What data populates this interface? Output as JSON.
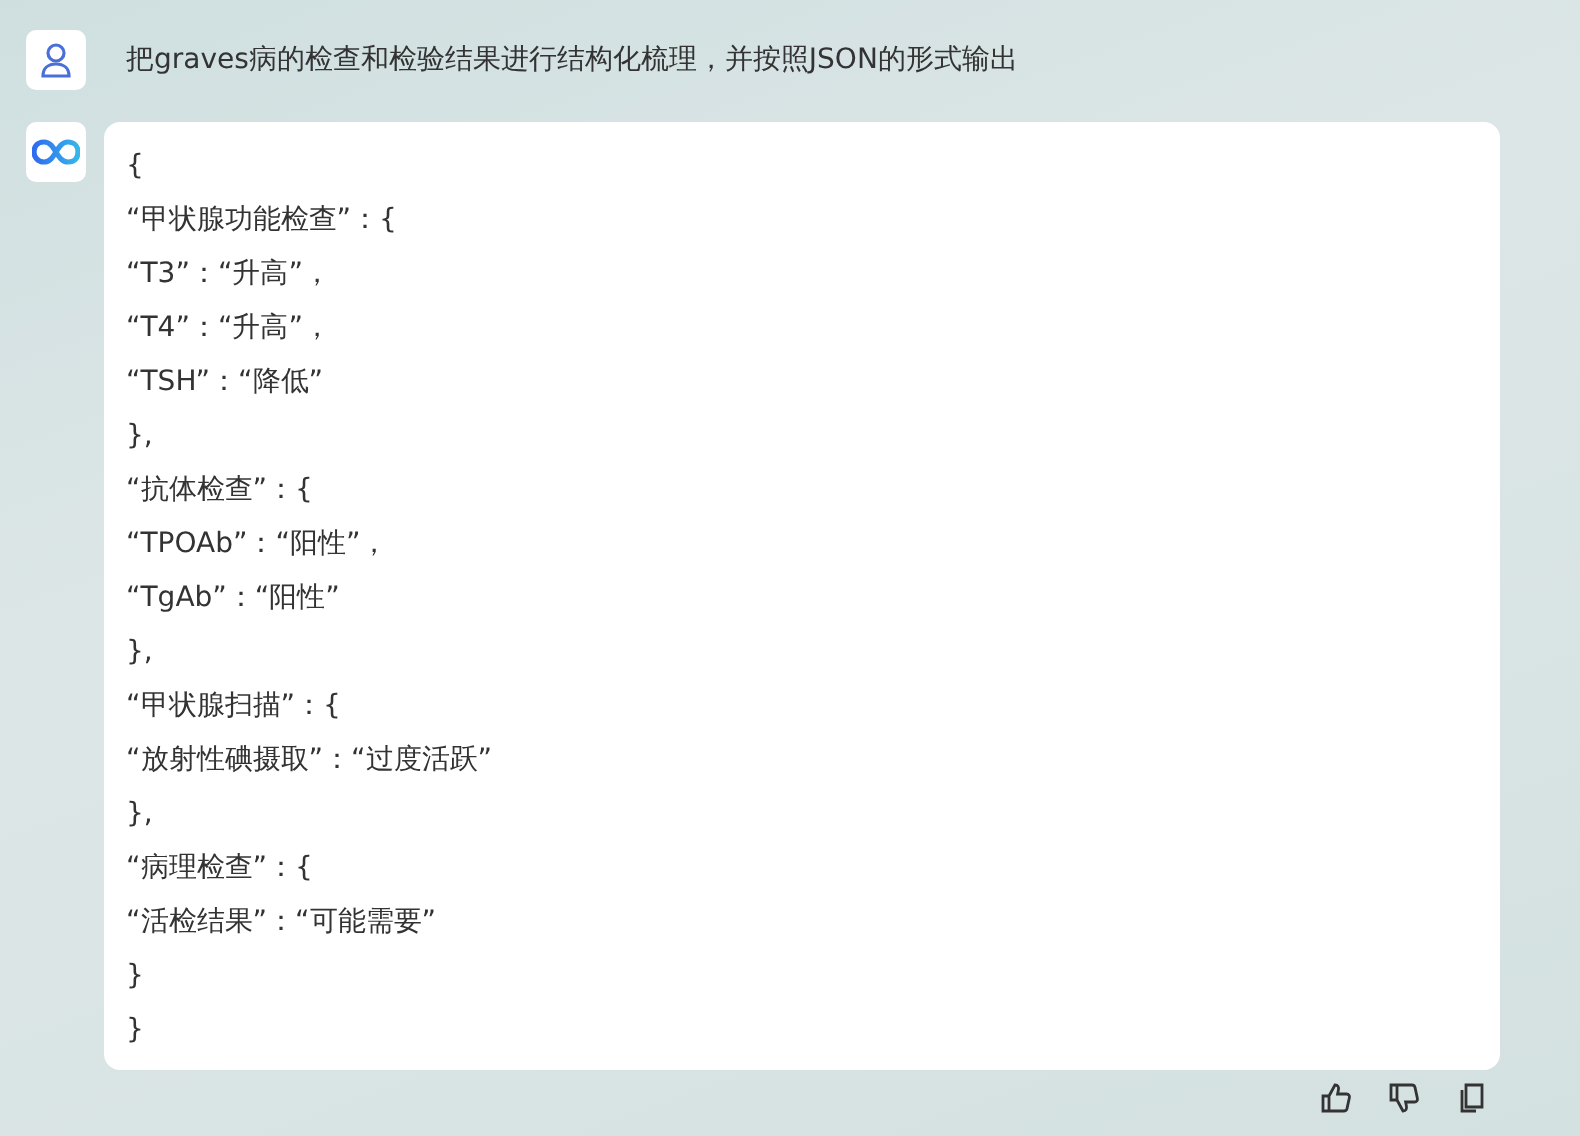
{
  "user_message": {
    "text": "把graves病的检查和检验结果进行结构化梳理，并按照JSON的形式输出"
  },
  "reply": {
    "lines": [
      "{",
      "“甲状腺功能检查”：{",
      "“T3”：“升高”，",
      "“T4”：“升高”，",
      "“TSH”：“降低”",
      "},",
      "“抗体检查”：{",
      "“TPOAb”：“阳性”，",
      "“TgAb”：“阳性”",
      "},",
      "“甲状腺扫描”：{",
      "“放射性碘摄取”：“过度活跃”",
      "},",
      "“病理检查”：{",
      "“活检结果”：“可能需要”",
      "}",
      "}"
    ]
  }
}
